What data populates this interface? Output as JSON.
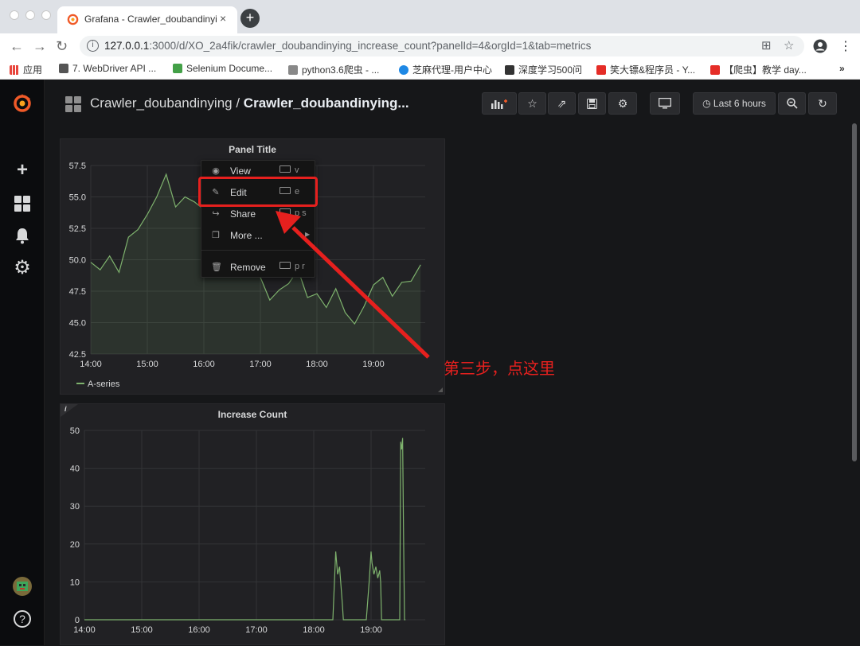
{
  "browser": {
    "tab_title": "Grafana - Crawler_doubandinying",
    "tab_close": "×",
    "new_tab": "+",
    "url_host": "127.0.0.1",
    "url_rest": ":3000/d/XO_2a4fik/crawler_doubandinying_increase_count?panelId=4&orgId=1&tab=metrics",
    "bookmarks": [
      {
        "label": "应用",
        "color": "#e8453c"
      },
      {
        "label": "7. WebDriver API ...",
        "color": "#555555"
      },
      {
        "label": "Selenium Docume...",
        "color": "#43a047"
      },
      {
        "label": "python3.6爬虫 - ...",
        "color": "#888888"
      },
      {
        "label": "芝麻代理-用户中心",
        "color": "#1e88e5"
      },
      {
        "label": "深度学习500问",
        "color": "#333333"
      },
      {
        "label": "笑大镖&程序员 - Y...",
        "color": "#e52d27"
      },
      {
        "label": "【爬虫】教学 day...",
        "color": "#e52d27"
      }
    ],
    "bookmarks_more": "»"
  },
  "navbar": {
    "folder": "Crawler_doubandinying",
    "separator": " / ",
    "dashboard": "Crawler_doubandinying...",
    "time_range": "Last 6 hours"
  },
  "panel1": {
    "title": "Panel Title",
    "legend": "A-series"
  },
  "panel2": {
    "title": "Increase Count",
    "info": "i"
  },
  "context_menu": [
    {
      "label": "View",
      "shortcut": "v",
      "icon": "eye-icon"
    },
    {
      "label": "Edit",
      "shortcut": "e",
      "icon": "edit-icon"
    },
    {
      "label": "Share",
      "shortcut": "p s",
      "icon": "share-icon"
    },
    {
      "label": "More ...",
      "shortcut": "",
      "icon": "cube-icon"
    },
    {
      "label": "Remove",
      "shortcut": "p r",
      "icon": "trash-icon"
    }
  ],
  "annotation": "第三步，点这里",
  "colors": {
    "series": "#7eb26d",
    "annotation": "#e6201e",
    "background": "#161719",
    "panel": "#212124"
  },
  "chart_data": [
    {
      "type": "area",
      "title": "Panel Title",
      "x_ticks": [
        "14:00",
        "15:00",
        "16:00",
        "17:00",
        "18:00",
        "19:00"
      ],
      "y_ticks": [
        "42.5",
        "45.0",
        "47.5",
        "50.0",
        "52.5",
        "55.0",
        "57.5"
      ],
      "ylim": [
        42.5,
        57.5
      ],
      "grid": true,
      "legend": "bottom-left",
      "series": [
        {
          "name": "A-series",
          "x": [
            "14:00",
            "14:10",
            "14:20",
            "14:30",
            "14:40",
            "14:50",
            "15:00",
            "15:10",
            "15:20",
            "15:30",
            "15:40",
            "15:50",
            "16:00",
            "16:10",
            "16:20",
            "16:30",
            "16:40",
            "16:50",
            "17:00",
            "17:10",
            "17:20",
            "17:30",
            "17:40",
            "17:50",
            "18:00",
            "18:10",
            "18:20",
            "18:30",
            "18:40",
            "18:50",
            "19:00",
            "19:10",
            "19:20",
            "19:30",
            "19:40",
            "19:50"
          ],
          "y": [
            49.8,
            49.2,
            50.3,
            49.0,
            51.8,
            52.4,
            53.6,
            55.0,
            56.8,
            54.2,
            55.0,
            54.6,
            54.0,
            55.3,
            53.1,
            52.4,
            53.8,
            52.0,
            48.6,
            46.8,
            47.6,
            48.1,
            49.2,
            47.0,
            47.3,
            46.2,
            47.7,
            45.8,
            44.9,
            46.3,
            48.0,
            48.6,
            47.1,
            48.2,
            48.3,
            49.6
          ]
        }
      ]
    },
    {
      "type": "line",
      "title": "Increase Count",
      "x_ticks": [
        "14:00",
        "15:00",
        "16:00",
        "17:00",
        "18:00",
        "19:00"
      ],
      "y_ticks": [
        "0",
        "10",
        "20",
        "30",
        "40",
        "50"
      ],
      "ylim": [
        0,
        50
      ],
      "grid": true,
      "series": [
        {
          "x": [
            "14:00",
            "18:20",
            "18:23",
            "18:25",
            "18:27",
            "18:30",
            "18:31",
            "18:55",
            "18:58",
            "19:00",
            "19:01",
            "19:03",
            "19:05",
            "19:07",
            "19:09",
            "19:10",
            "19:11",
            "19:12",
            "19:25",
            "19:30",
            "19:31",
            "19:32",
            "19:33",
            "19:34",
            "19:35",
            "19:36"
          ],
          "y": [
            0,
            0,
            18,
            12,
            14,
            4,
            0,
            0,
            10,
            18,
            15,
            12,
            14,
            11,
            13,
            10,
            0,
            0,
            0,
            0,
            47,
            45,
            48,
            22,
            0,
            0
          ]
        }
      ]
    }
  ]
}
